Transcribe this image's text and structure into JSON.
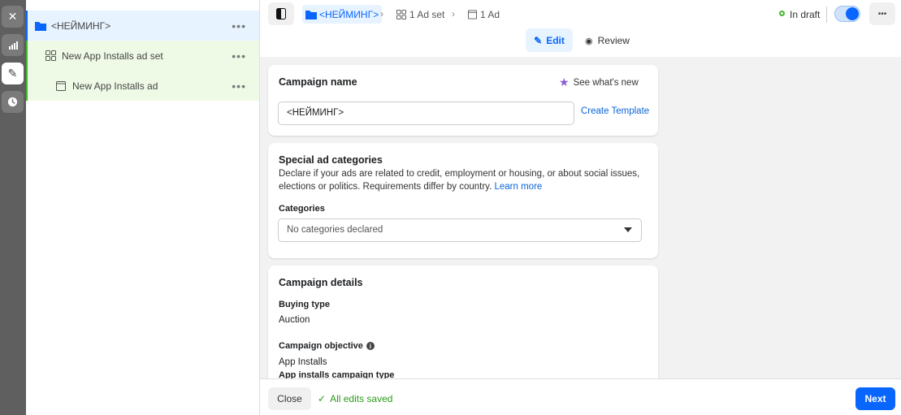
{
  "rail": {
    "items": [
      {
        "icon": "close-icon"
      },
      {
        "icon": "chart-icon"
      },
      {
        "icon": "pencil-icon",
        "active": true
      },
      {
        "icon": "clock-icon"
      }
    ]
  },
  "tree": {
    "campaign": "<НЕЙМИНГ>",
    "adset": "New App Installs ad set",
    "ad": "New App Installs ad",
    "more": "•••"
  },
  "header": {
    "breadcrumb": {
      "campaign": "<НЕЙМИНГ>",
      "adset": "1 Ad set",
      "ad": "1 Ad"
    },
    "status": "In draft",
    "toggle_on": true,
    "more": "•••",
    "tabs": {
      "edit": "Edit",
      "review": "Review"
    },
    "status_color": "#42b72a",
    "accent": "#0866ff"
  },
  "campaign_name": {
    "title": "Campaign name",
    "whats_new": "See what's new",
    "value": "<НЕЙМИНГ>",
    "create_template": "Create Template"
  },
  "special": {
    "title": "Special ad categories",
    "desc": "Declare if your ads are related to credit, employment or housing, or about social issues, elections or politics. Requirements differ by country.",
    "learn_more": "Learn more",
    "categories_label": "Categories",
    "categories_value": "No categories declared"
  },
  "details": {
    "title": "Campaign details",
    "buying_type_label": "Buying type",
    "buying_type": "Auction",
    "objective_label": "Campaign objective",
    "objective": "App Installs",
    "type_label": "App installs campaign type"
  },
  "footer": {
    "close": "Close",
    "saved": "All edits saved",
    "next": "Next"
  }
}
